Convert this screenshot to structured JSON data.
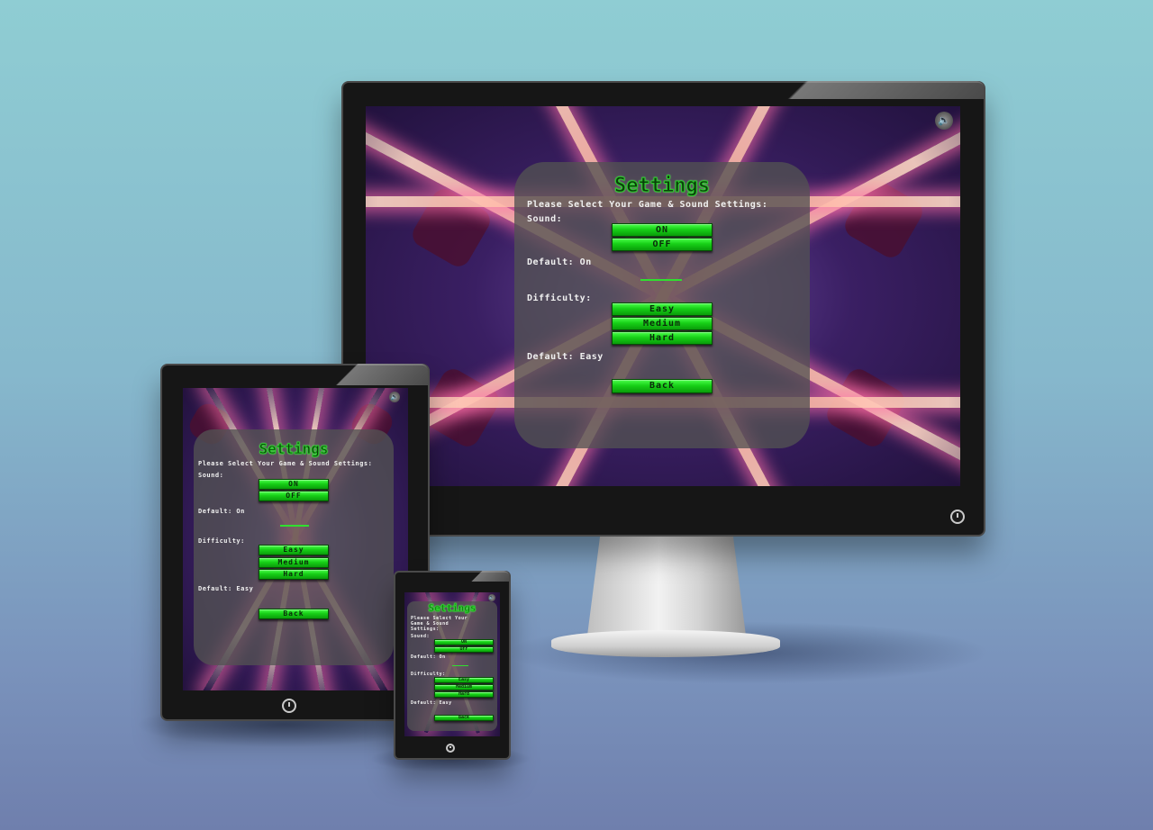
{
  "settings": {
    "title": "Settings",
    "prompt": "Please Select Your Game & Sound Settings:",
    "prompt_wrapped_line1": "Please Select Your",
    "prompt_wrapped_line2": "Game & Sound",
    "prompt_wrapped_line3": "Settings:",
    "sound_label": "Sound:",
    "sound_on": "ON",
    "sound_off": "OFF",
    "sound_default": "Default: On",
    "difficulty_label": "Difficulty:",
    "difficulty_easy": "Easy",
    "difficulty_medium": "Medium",
    "difficulty_hard": "Hard",
    "difficulty_default": "Default: Easy",
    "back": "Back"
  },
  "colors": {
    "button_green": "#17d017",
    "panel_gray": "#525252",
    "title_green": "#27c927",
    "background_top": "#8fcdd3",
    "background_bottom": "#6f7fad"
  },
  "icons": {
    "sound": "speaker-icon",
    "power": "power-icon"
  }
}
